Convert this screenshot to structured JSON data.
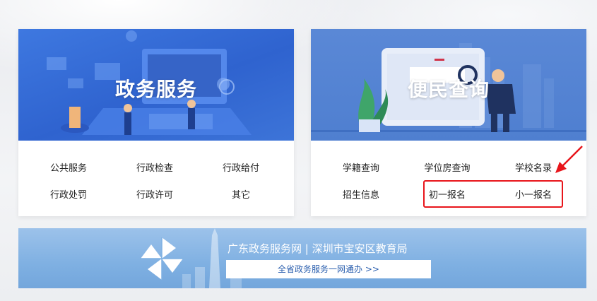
{
  "left_card": {
    "title": "政务服务",
    "links": [
      "公共服务",
      "行政检查",
      "行政给付",
      "行政处罚",
      "行政许可",
      "其它"
    ]
  },
  "right_card": {
    "title": "便民查询",
    "links": [
      "学籍查询",
      "学位房查询",
      "学校名录",
      "招生信息",
      "初一报名",
      "小一报名"
    ]
  },
  "gov_banner": {
    "title": "广东政务服务网 | 深圳市宝安区教育局",
    "button": "全省政务服务一网通办 >>"
  },
  "colors": {
    "highlight": "#e8151b",
    "left_banner": "#2f63cf",
    "right_banner": "#5a88d6",
    "gov_banner": "#7fb0e2"
  }
}
